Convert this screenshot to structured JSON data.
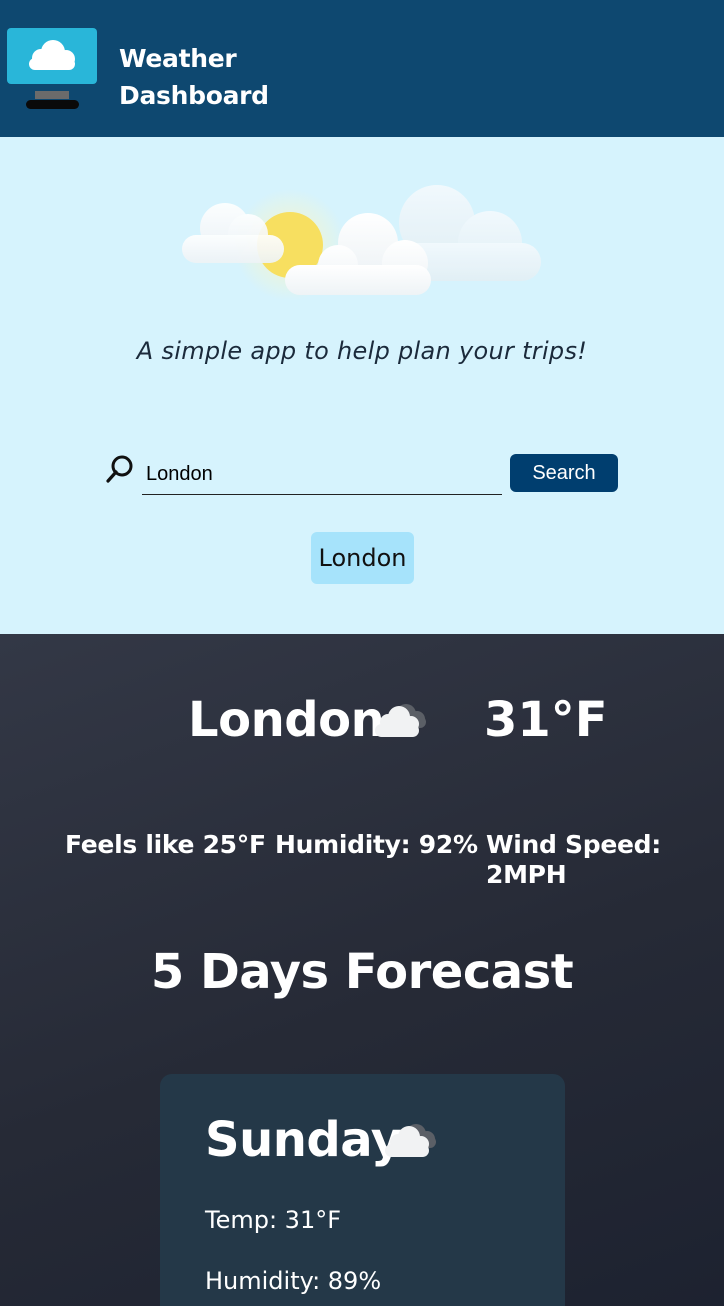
{
  "header": {
    "title_line1": "Weather",
    "title_line2": "Dashboard",
    "logo_icon": "cloud-monitor-icon"
  },
  "hero": {
    "illustration_icon": "sun-clouds-icon",
    "tagline": "A simple app to help plan your trips!"
  },
  "search": {
    "icon": "search-icon",
    "value": "London",
    "button_label": "Search",
    "history": [
      "London"
    ]
  },
  "current": {
    "city": "London",
    "condition_icon": "cloud-icon",
    "temperature": "31°F",
    "feels_like": "Feels like 25°F",
    "humidity": "Humidity: 92%",
    "wind_speed": "Wind Speed: 2MPH"
  },
  "forecast": {
    "title": "5 Days Forecast",
    "days": [
      {
        "day": "Sunday",
        "condition_icon": "cloud-icon",
        "temp": "Temp: 31°F",
        "humidity": "Humidity: 89%"
      }
    ]
  },
  "colors": {
    "header_bg": "#0e4870",
    "hero_bg": "#d6f3fd",
    "button_bg": "#003e6f",
    "chip_bg": "#a6e3fb",
    "weather_bg": "#2a2e3b",
    "card_bg": "#243848"
  }
}
